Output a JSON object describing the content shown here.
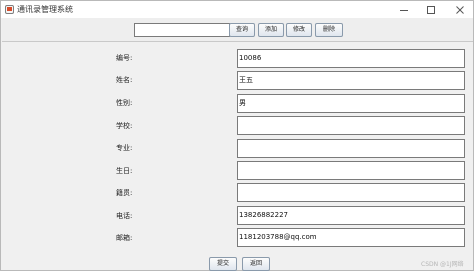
{
  "window": {
    "title": "通讯录管理系统"
  },
  "toolbar": {
    "search_value": "",
    "query_label": "查询",
    "add_label": "添加",
    "edit_label": "修改",
    "delete_label": "删除"
  },
  "form": {
    "fields": [
      {
        "label": "编号:",
        "value": "10086"
      },
      {
        "label": "姓名:",
        "value": "王五"
      },
      {
        "label": "性别:",
        "value": "男"
      },
      {
        "label": "学校:",
        "value": ""
      },
      {
        "label": "专业:",
        "value": ""
      },
      {
        "label": "生日:",
        "value": ""
      },
      {
        "label": "籍贯:",
        "value": ""
      },
      {
        "label": "电话:",
        "value": "13826882227"
      },
      {
        "label": "邮箱:",
        "value": "1181203788@qq.com"
      }
    ]
  },
  "footer": {
    "submit_label": "提交",
    "back_label": "返回"
  },
  "watermark": {
    "text": "CSDN @1J网络"
  }
}
